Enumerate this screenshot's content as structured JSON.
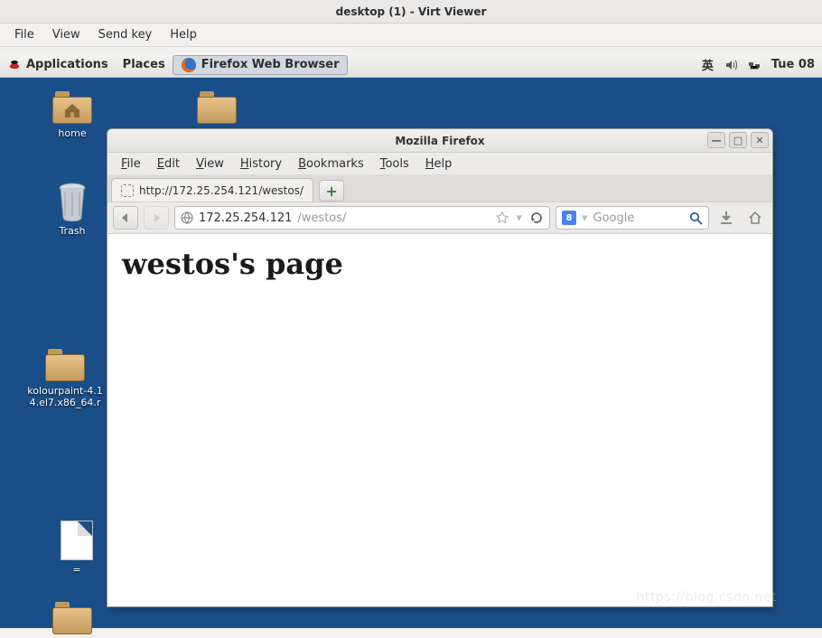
{
  "virt_viewer": {
    "title": "desktop (1) - Virt Viewer",
    "menu": {
      "file": "File",
      "view": "View",
      "send_key": "Send key",
      "help": "Help"
    }
  },
  "gnome_panel": {
    "applications": "Applications",
    "places": "Places",
    "active_app": "Firefox Web Browser",
    "ime": "英",
    "clock": "Tue 08"
  },
  "desktop_icons": {
    "home": "home",
    "trash": "Trash",
    "kolourpaint": "kolourpaint-4.1\n4.el7.x86_64.r",
    "equals": "="
  },
  "firefox": {
    "title": "Mozilla Firefox",
    "menu": {
      "file": "File",
      "edit": "Edit",
      "view": "View",
      "history": "History",
      "bookmarks": "Bookmarks",
      "tools": "Tools",
      "help": "Help"
    },
    "tab": {
      "label": "http://172.25.254.121/westos/"
    },
    "newtab_glyph": "+",
    "urlbar": {
      "host": "172.25.254.121",
      "path": "/westos/"
    },
    "search": {
      "placeholder": "Google"
    },
    "page": {
      "heading": "westos's page"
    },
    "win_btns": {
      "min": "—",
      "max": "□",
      "close": "✕"
    }
  },
  "watermark": "https://blog.csdn.net"
}
